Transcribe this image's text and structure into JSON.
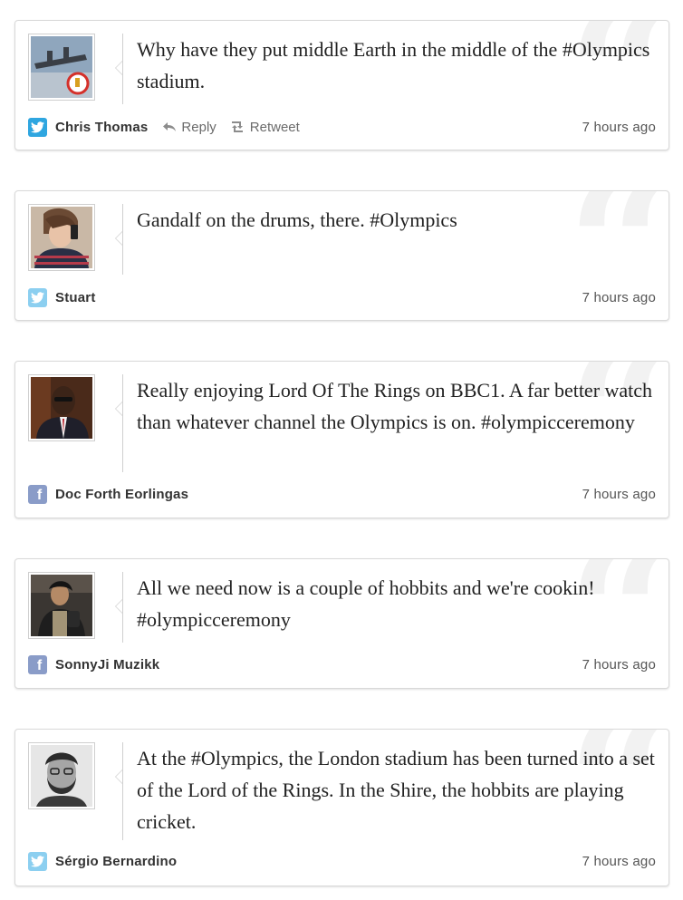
{
  "tweets": [
    {
      "text": "Why have they put middle Earth in the middle of the #Olympics stadium.",
      "author": "Chris Thomas",
      "service": "twitter",
      "time": "7 hours ago",
      "actions": {
        "reply": "Reply",
        "retweet": "Retweet"
      }
    },
    {
      "text": "Gandalf on the drums, there. #Olympics",
      "author": "Stuart",
      "service": "twitter",
      "time": "7 hours ago"
    },
    {
      "text": "Really enjoying Lord Of The Rings on BBC1. A far better watch than whatever channel the Olympics is on. #olympicceremony",
      "author": "Doc Forth Eorlingas",
      "service": "facebook",
      "time": "7 hours ago"
    },
    {
      "text": "All we need now is a couple of hobbits and we're cookin! #olympicceremony",
      "author": "SonnyJi Muzikk",
      "service": "facebook",
      "time": "7 hours ago"
    },
    {
      "text": "At the #Olympics, the London stadium has been turned into a set of the Lord of the Rings. In the Shire, the hobbits are playing cricket.",
      "author": "Sérgio Bernardino",
      "service": "twitter",
      "time": "7 hours ago"
    }
  ],
  "colors": {
    "twitter": "#2fa6e0",
    "facebook": "#8a9cc8",
    "quote_mark": "#f2f2f2"
  }
}
